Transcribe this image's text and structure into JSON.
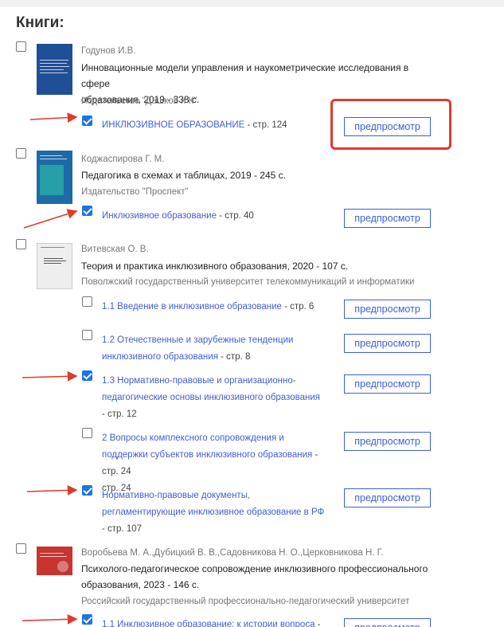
{
  "heading": "Книги:",
  "preview_label": "предпросмотр",
  "accent_color": "#3d5fd6",
  "annotation_color": "#e03a2f",
  "books": [
    {
      "author": "Годунов И.В.",
      "title_lines": [
        "Инновационные модели управления и наукометрические исследования в сфере",
        "образования, 2019 - 338 с."
      ],
      "publisher": "Издательство \"Дашков и К\"",
      "checked": false,
      "chapters": [
        {
          "lines": [
            "ИНКЛЮЗИВНОЕ ОБРАЗОВАНИЕ"
          ],
          "page": " - стр. 124",
          "checked": true
        }
      ]
    },
    {
      "author": "Коджаспирова Г. М.",
      "title_lines": [
        "Педагогика в схемах и таблицах, 2019 - 245 с."
      ],
      "publisher": "Издательство \"Проспект\"",
      "checked": false,
      "chapters": [
        {
          "lines": [
            "Инклюзивное образование"
          ],
          "page": " - стр. 40",
          "checked": true
        }
      ]
    },
    {
      "author": "Витевская О. В.",
      "title_lines": [
        "Теория и практика инклюзивного образования, 2020 - 107 с."
      ],
      "publisher": "Поволжский государственный университет телекоммуникаций и информатики",
      "checked": false,
      "chapters": [
        {
          "lines": [
            "1.1 Введение в инклюзивное образование"
          ],
          "page": " - стр. 6",
          "checked": false
        },
        {
          "lines": [
            "1.2 Отечественные и зарубежные тенденции",
            "инклюзивного образования"
          ],
          "page": " - стр. 8",
          "checked": false
        },
        {
          "lines": [
            "1.3 Нормативно-правовые и организационно-",
            "педагогические основы инклюзивного образования"
          ],
          "page": "- стр. 12",
          "checked": true
        },
        {
          "lines": [
            "2 Вопросы комплексного сопровождения и",
            "поддержки субъектов инклюзивного образования"
          ],
          "page": " - стр. 24",
          "checked": false
        },
        {
          "lines": [
            "Нормативно-правовые документы,",
            "регламентирующие инклюзивное образование в РФ"
          ],
          "page": "- стр. 107",
          "checked": true
        }
      ]
    },
    {
      "author": "Воробьева М. А.,Дубицкий В. В.,Садовникова Н. О.,Церковникова Н. Г.",
      "title_lines": [
        "Психолого-педагогическое сопровождение инклюзивного профессионального",
        "образования, 2023 - 146 с."
      ],
      "publisher": "Российский государственный профессионально-педагогический университет",
      "checked": false,
      "chapters": [
        {
          "lines": [
            "1.1 Инклюзивное образование: к истории вопроса"
          ],
          "page": " -",
          "checked": true
        }
      ]
    }
  ]
}
